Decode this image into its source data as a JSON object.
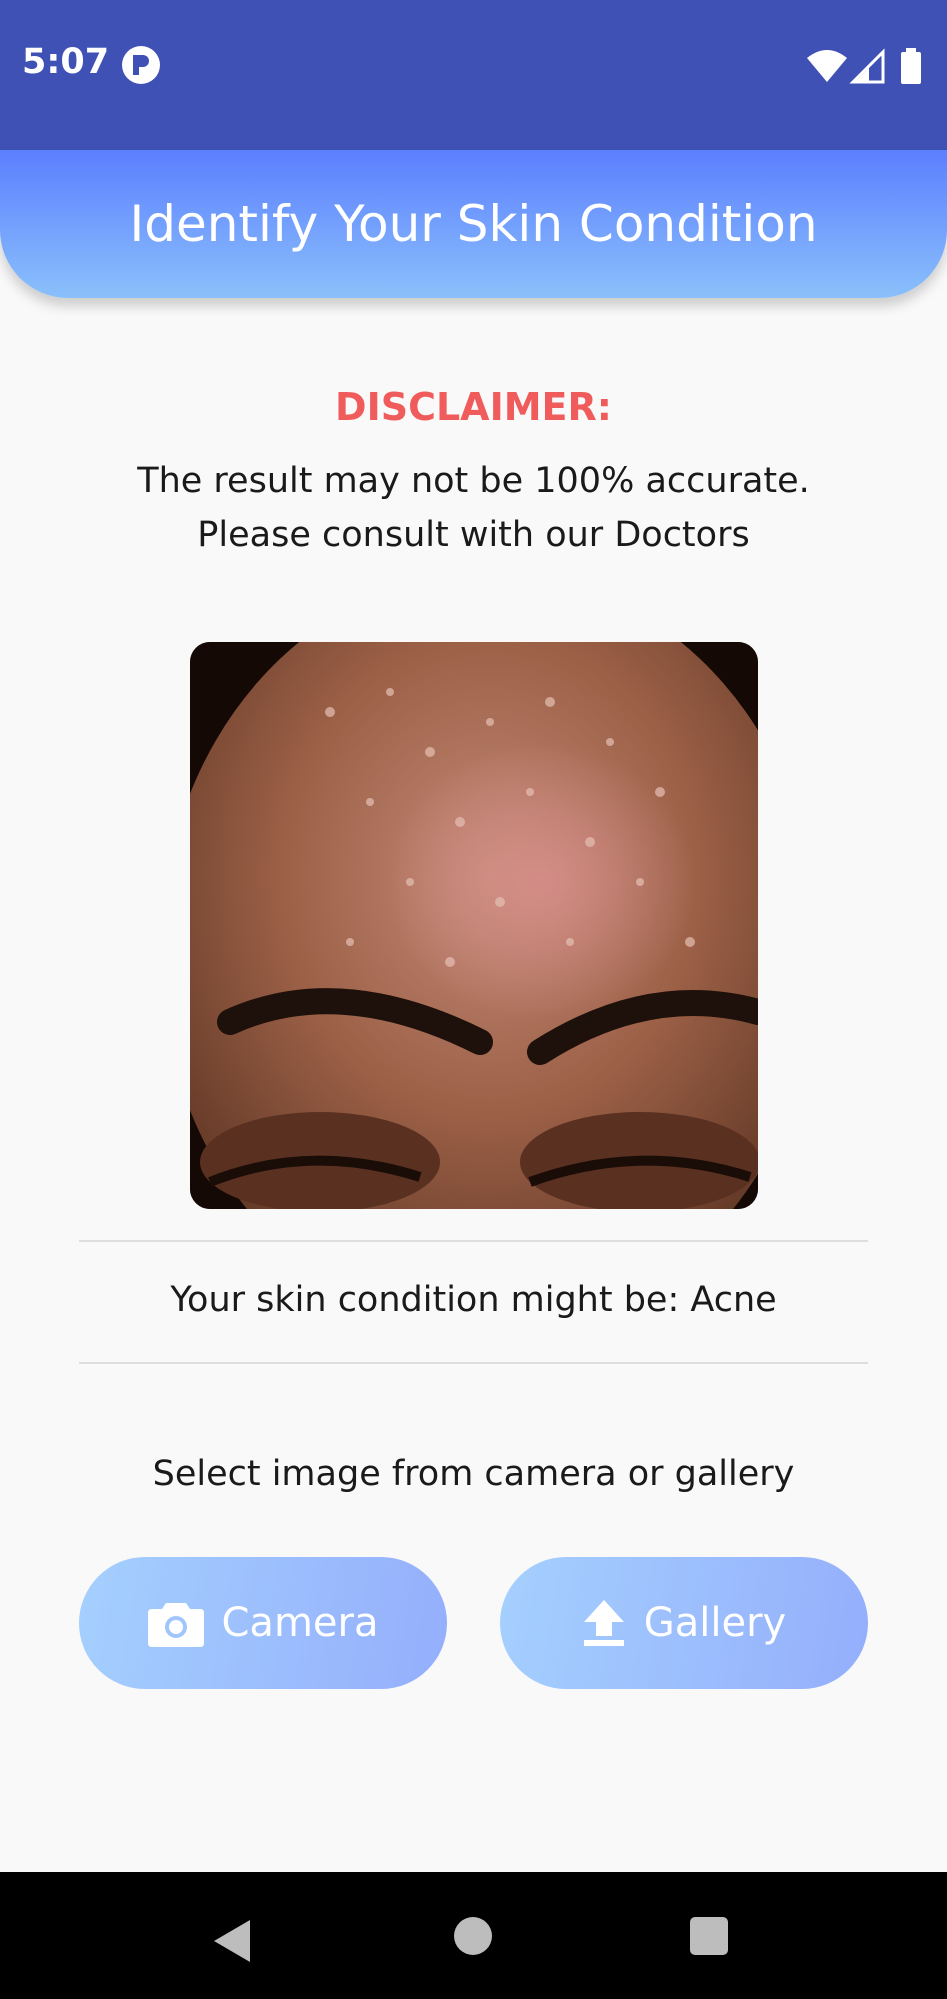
{
  "status_bar": {
    "time": "5:07",
    "icons": [
      "app-icon",
      "wifi-icon",
      "signal-icon",
      "battery-icon"
    ]
  },
  "header": {
    "title": "Identify Your Skin Condition"
  },
  "disclaimer": {
    "title": "DISCLAIMER:",
    "line1": "The result may not be 100% accurate.",
    "line2": "Please consult with our Doctors"
  },
  "result": {
    "text": "Your skin condition might be: Acne"
  },
  "instructions": {
    "text": "Select image from camera or gallery"
  },
  "buttons": {
    "camera": {
      "label": "Camera",
      "icon": "camera-icon"
    },
    "gallery": {
      "label": "Gallery",
      "icon": "upload-icon"
    }
  },
  "nav": {
    "icons": [
      "back-icon",
      "home-icon",
      "recents-icon"
    ]
  },
  "colors": {
    "status_bar": "#3f51b5",
    "header_gradient_top": "#5c7fff",
    "header_gradient_bottom": "#8ac0fb",
    "disclaimer": "#f05c5c",
    "button_gradient_start": "#a5d0fe",
    "button_gradient_end": "#94aefc"
  }
}
